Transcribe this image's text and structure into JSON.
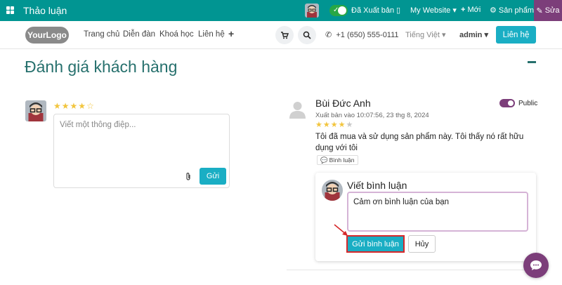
{
  "adminbar": {
    "app_title": "Thảo luận",
    "published_label": "Đã Xuất bản",
    "website_label": "My Website",
    "new_label": "Mới",
    "products_label": "Sản phẩm",
    "edit_label": "Sửa"
  },
  "header": {
    "logo_text": "YourLogo",
    "nav": [
      "Trang chủ",
      "Diễn đàn",
      "Khoá học",
      "Liên hệ"
    ],
    "phone": "+1 (650) 555-0111",
    "language": "Tiếng Việt",
    "user": "admin",
    "contact_button": "Liên hệ"
  },
  "page": {
    "title": "Đánh giá khách hàng"
  },
  "composer": {
    "rating": 4,
    "max_rating": 5,
    "placeholder": "Viết một thông điệp...",
    "send_label": "Gửi"
  },
  "review": {
    "author": "Bùi Đức Anh",
    "date": "Xuất bản vào 10:07:56, 23 thg 8, 2024",
    "rating": 4,
    "max_rating": 5,
    "text": "Tôi đã mua và sử dụng sản phẩm này. Tôi thấy nó rất hữu dụng với tôi",
    "comment_badge": "Bình luận",
    "public_label": "Public"
  },
  "comment_form": {
    "title": "Viết bình luận",
    "value": "Cảm ơn bình luận của bạn",
    "submit_label": "Gửi bình luận",
    "cancel_label": "Hủy"
  },
  "colors": {
    "topbar": "#019592",
    "accent": "#1aaec4",
    "brand_purple": "#7c3e7a",
    "heading": "#26706d",
    "highlight": "#d6282a"
  }
}
